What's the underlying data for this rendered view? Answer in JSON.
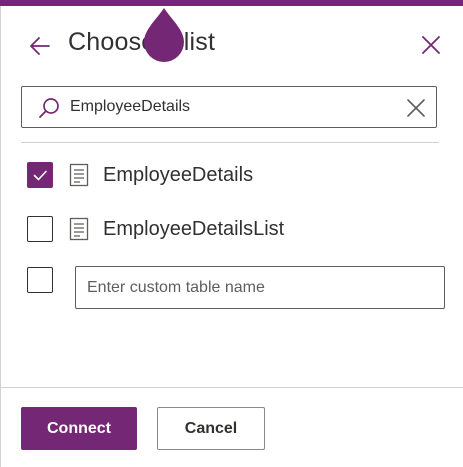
{
  "header": {
    "title": "Choose a list",
    "back_icon": "arrow-left-icon",
    "close_icon": "close-icon"
  },
  "search": {
    "value": "EmployeeDetails",
    "icon": "search-icon",
    "clear_icon": "clear-icon"
  },
  "lists": [
    {
      "label": "EmployeeDetails",
      "checked": true,
      "icon": "list-icon"
    },
    {
      "label": "EmployeeDetailsList",
      "checked": false,
      "icon": "list-icon"
    }
  ],
  "custom_table": {
    "checked": false,
    "placeholder": "Enter custom table name",
    "value": ""
  },
  "footer": {
    "connect_label": "Connect",
    "cancel_label": "Cancel"
  },
  "colors": {
    "accent": "#742774",
    "text": "#323130",
    "border": "#605e5c",
    "divider": "#d2d0ce"
  }
}
